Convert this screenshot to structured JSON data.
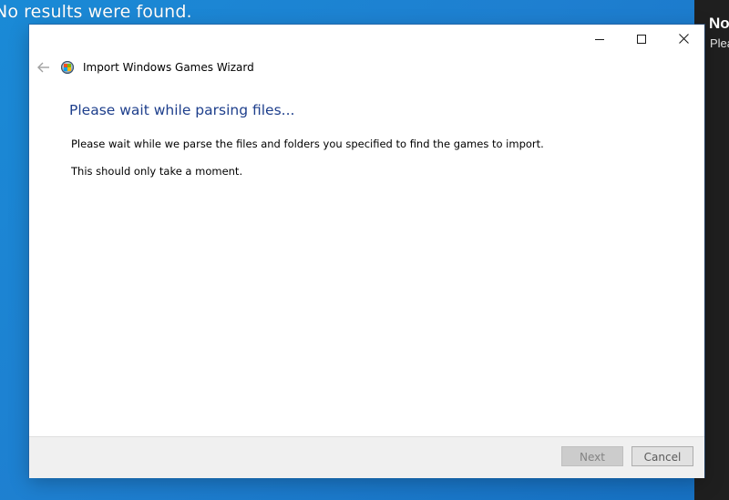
{
  "desktop": {
    "search_message": "No results were found."
  },
  "side_panel": {
    "title": "No",
    "subtitle": "Plea"
  },
  "window": {
    "title": "Import Windows Games Wizard",
    "controls": {
      "minimize": "minimize-icon",
      "maximize": "maximize-icon",
      "close": "close-icon"
    },
    "back_icon": "back-arrow-icon",
    "app_icon": "windows-games-icon"
  },
  "content": {
    "heading": "Please wait while parsing files...",
    "line1": "Please wait while we parse the files and folders you specified to find the games to import.",
    "line2": "This should only take a moment."
  },
  "footer": {
    "next_label": "Next",
    "next_enabled": false,
    "cancel_label": "Cancel"
  },
  "colors": {
    "heading": "#1e3f8c",
    "desktop": "#1a8ad6",
    "side_panel": "#1f1f1f"
  }
}
